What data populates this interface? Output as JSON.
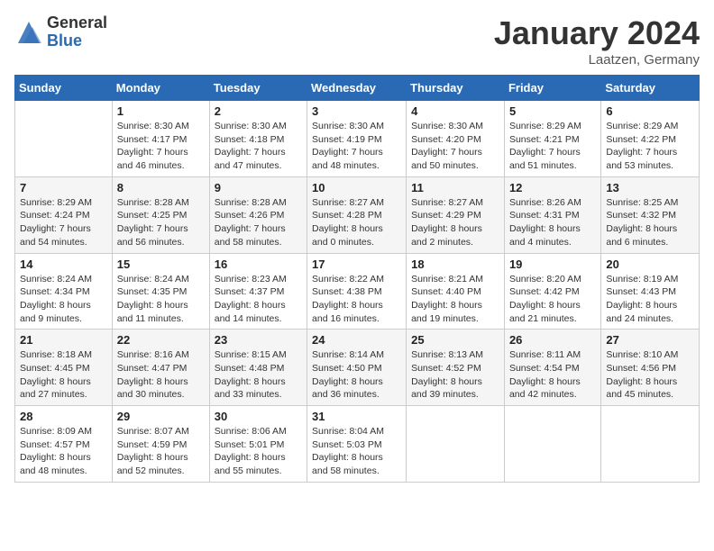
{
  "logo": {
    "general": "General",
    "blue": "Blue"
  },
  "header": {
    "month": "January 2024",
    "location": "Laatzen, Germany"
  },
  "weekdays": [
    "Sunday",
    "Monday",
    "Tuesday",
    "Wednesday",
    "Thursday",
    "Friday",
    "Saturday"
  ],
  "weeks": [
    [
      {
        "day": "",
        "sunrise": "",
        "sunset": "",
        "daylight": ""
      },
      {
        "day": "1",
        "sunrise": "Sunrise: 8:30 AM",
        "sunset": "Sunset: 4:17 PM",
        "daylight": "Daylight: 7 hours and 46 minutes."
      },
      {
        "day": "2",
        "sunrise": "Sunrise: 8:30 AM",
        "sunset": "Sunset: 4:18 PM",
        "daylight": "Daylight: 7 hours and 47 minutes."
      },
      {
        "day": "3",
        "sunrise": "Sunrise: 8:30 AM",
        "sunset": "Sunset: 4:19 PM",
        "daylight": "Daylight: 7 hours and 48 minutes."
      },
      {
        "day": "4",
        "sunrise": "Sunrise: 8:30 AM",
        "sunset": "Sunset: 4:20 PM",
        "daylight": "Daylight: 7 hours and 50 minutes."
      },
      {
        "day": "5",
        "sunrise": "Sunrise: 8:29 AM",
        "sunset": "Sunset: 4:21 PM",
        "daylight": "Daylight: 7 hours and 51 minutes."
      },
      {
        "day": "6",
        "sunrise": "Sunrise: 8:29 AM",
        "sunset": "Sunset: 4:22 PM",
        "daylight": "Daylight: 7 hours and 53 minutes."
      }
    ],
    [
      {
        "day": "7",
        "sunrise": "Sunrise: 8:29 AM",
        "sunset": "Sunset: 4:24 PM",
        "daylight": "Daylight: 7 hours and 54 minutes."
      },
      {
        "day": "8",
        "sunrise": "Sunrise: 8:28 AM",
        "sunset": "Sunset: 4:25 PM",
        "daylight": "Daylight: 7 hours and 56 minutes."
      },
      {
        "day": "9",
        "sunrise": "Sunrise: 8:28 AM",
        "sunset": "Sunset: 4:26 PM",
        "daylight": "Daylight: 7 hours and 58 minutes."
      },
      {
        "day": "10",
        "sunrise": "Sunrise: 8:27 AM",
        "sunset": "Sunset: 4:28 PM",
        "daylight": "Daylight: 8 hours and 0 minutes."
      },
      {
        "day": "11",
        "sunrise": "Sunrise: 8:27 AM",
        "sunset": "Sunset: 4:29 PM",
        "daylight": "Daylight: 8 hours and 2 minutes."
      },
      {
        "day": "12",
        "sunrise": "Sunrise: 8:26 AM",
        "sunset": "Sunset: 4:31 PM",
        "daylight": "Daylight: 8 hours and 4 minutes."
      },
      {
        "day": "13",
        "sunrise": "Sunrise: 8:25 AM",
        "sunset": "Sunset: 4:32 PM",
        "daylight": "Daylight: 8 hours and 6 minutes."
      }
    ],
    [
      {
        "day": "14",
        "sunrise": "Sunrise: 8:24 AM",
        "sunset": "Sunset: 4:34 PM",
        "daylight": "Daylight: 8 hours and 9 minutes."
      },
      {
        "day": "15",
        "sunrise": "Sunrise: 8:24 AM",
        "sunset": "Sunset: 4:35 PM",
        "daylight": "Daylight: 8 hours and 11 minutes."
      },
      {
        "day": "16",
        "sunrise": "Sunrise: 8:23 AM",
        "sunset": "Sunset: 4:37 PM",
        "daylight": "Daylight: 8 hours and 14 minutes."
      },
      {
        "day": "17",
        "sunrise": "Sunrise: 8:22 AM",
        "sunset": "Sunset: 4:38 PM",
        "daylight": "Daylight: 8 hours and 16 minutes."
      },
      {
        "day": "18",
        "sunrise": "Sunrise: 8:21 AM",
        "sunset": "Sunset: 4:40 PM",
        "daylight": "Daylight: 8 hours and 19 minutes."
      },
      {
        "day": "19",
        "sunrise": "Sunrise: 8:20 AM",
        "sunset": "Sunset: 4:42 PM",
        "daylight": "Daylight: 8 hours and 21 minutes."
      },
      {
        "day": "20",
        "sunrise": "Sunrise: 8:19 AM",
        "sunset": "Sunset: 4:43 PM",
        "daylight": "Daylight: 8 hours and 24 minutes."
      }
    ],
    [
      {
        "day": "21",
        "sunrise": "Sunrise: 8:18 AM",
        "sunset": "Sunset: 4:45 PM",
        "daylight": "Daylight: 8 hours and 27 minutes."
      },
      {
        "day": "22",
        "sunrise": "Sunrise: 8:16 AM",
        "sunset": "Sunset: 4:47 PM",
        "daylight": "Daylight: 8 hours and 30 minutes."
      },
      {
        "day": "23",
        "sunrise": "Sunrise: 8:15 AM",
        "sunset": "Sunset: 4:48 PM",
        "daylight": "Daylight: 8 hours and 33 minutes."
      },
      {
        "day": "24",
        "sunrise": "Sunrise: 8:14 AM",
        "sunset": "Sunset: 4:50 PM",
        "daylight": "Daylight: 8 hours and 36 minutes."
      },
      {
        "day": "25",
        "sunrise": "Sunrise: 8:13 AM",
        "sunset": "Sunset: 4:52 PM",
        "daylight": "Daylight: 8 hours and 39 minutes."
      },
      {
        "day": "26",
        "sunrise": "Sunrise: 8:11 AM",
        "sunset": "Sunset: 4:54 PM",
        "daylight": "Daylight: 8 hours and 42 minutes."
      },
      {
        "day": "27",
        "sunrise": "Sunrise: 8:10 AM",
        "sunset": "Sunset: 4:56 PM",
        "daylight": "Daylight: 8 hours and 45 minutes."
      }
    ],
    [
      {
        "day": "28",
        "sunrise": "Sunrise: 8:09 AM",
        "sunset": "Sunset: 4:57 PM",
        "daylight": "Daylight: 8 hours and 48 minutes."
      },
      {
        "day": "29",
        "sunrise": "Sunrise: 8:07 AM",
        "sunset": "Sunset: 4:59 PM",
        "daylight": "Daylight: 8 hours and 52 minutes."
      },
      {
        "day": "30",
        "sunrise": "Sunrise: 8:06 AM",
        "sunset": "Sunset: 5:01 PM",
        "daylight": "Daylight: 8 hours and 55 minutes."
      },
      {
        "day": "31",
        "sunrise": "Sunrise: 8:04 AM",
        "sunset": "Sunset: 5:03 PM",
        "daylight": "Daylight: 8 hours and 58 minutes."
      },
      {
        "day": "",
        "sunrise": "",
        "sunset": "",
        "daylight": ""
      },
      {
        "day": "",
        "sunrise": "",
        "sunset": "",
        "daylight": ""
      },
      {
        "day": "",
        "sunrise": "",
        "sunset": "",
        "daylight": ""
      }
    ]
  ]
}
